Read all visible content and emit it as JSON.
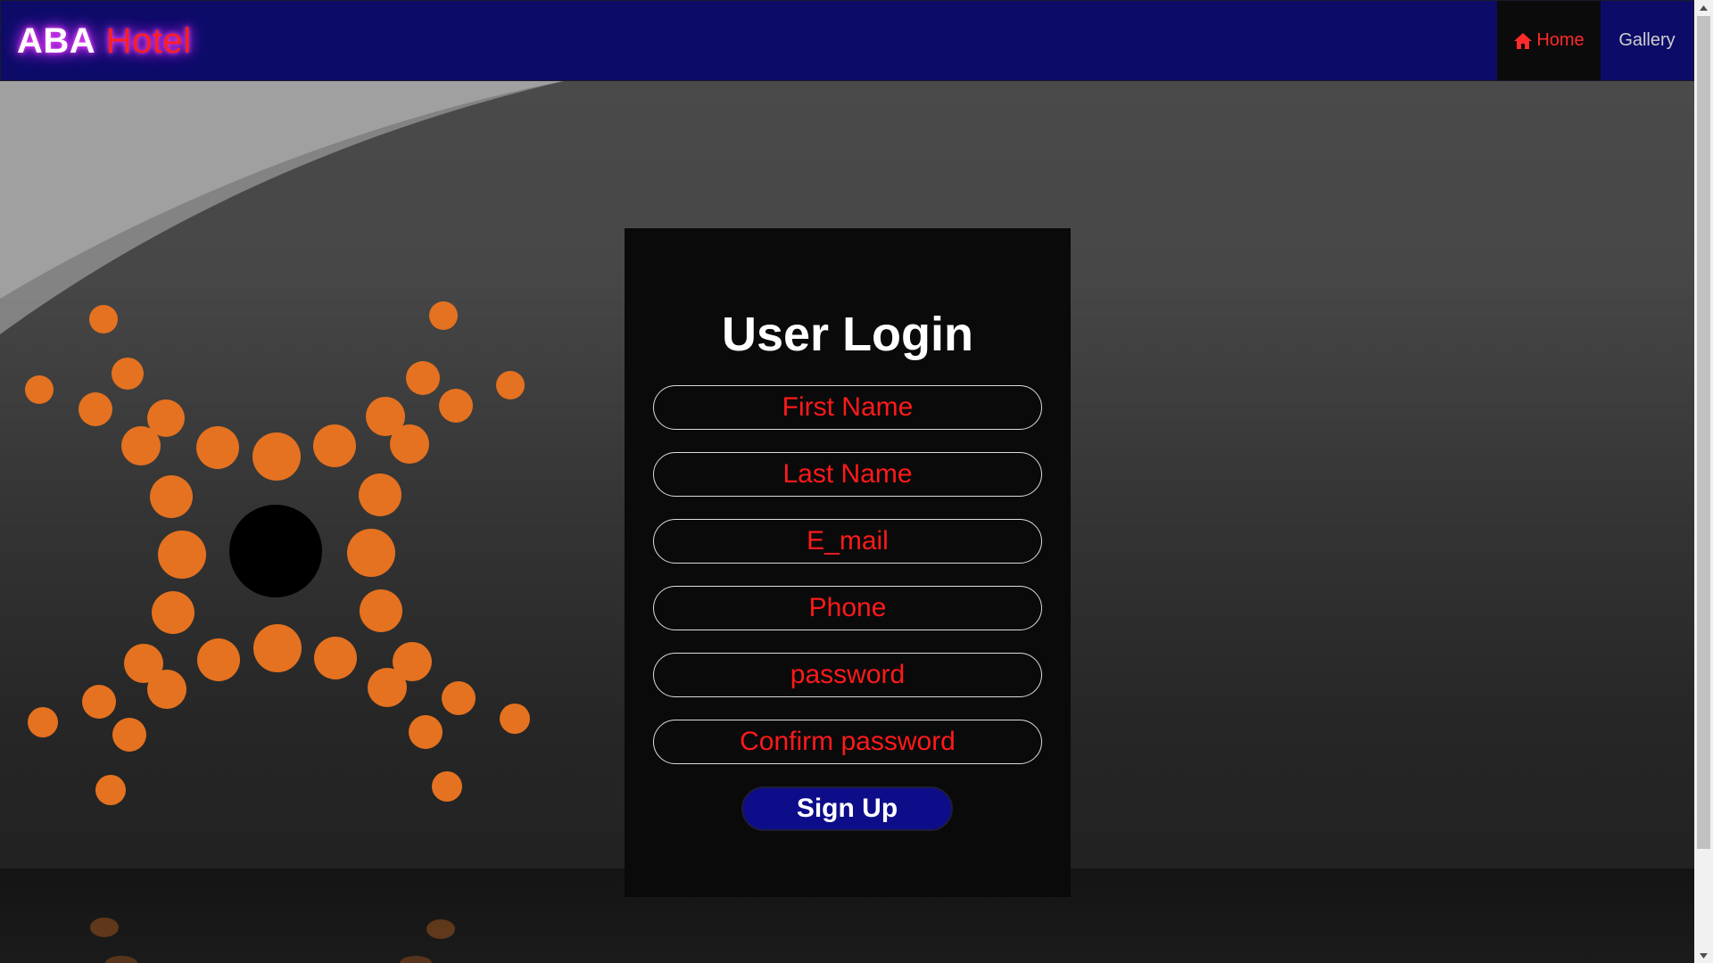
{
  "brand": {
    "part1": "ABA",
    "part2": "Hotel"
  },
  "nav": {
    "items": [
      {
        "label": "Home",
        "icon": "home-icon",
        "active": true
      },
      {
        "label": "Gallery"
      }
    ]
  },
  "login": {
    "title": "User Login",
    "fields": {
      "first_name": "First Name",
      "last_name": "Last Name",
      "email": "E_mail",
      "phone": "Phone",
      "password": "password",
      "confirm_password": "Confirm password"
    },
    "submit_label": "Sign Up"
  },
  "colors": {
    "navbar": "#0c0c68",
    "active_nav_bg": "#0b0b0b",
    "accent_red": "#ff1a1a",
    "button_blue": "#0d0d8a",
    "dot_orange": "#e57220",
    "card_bg": "#0a0a0a"
  }
}
